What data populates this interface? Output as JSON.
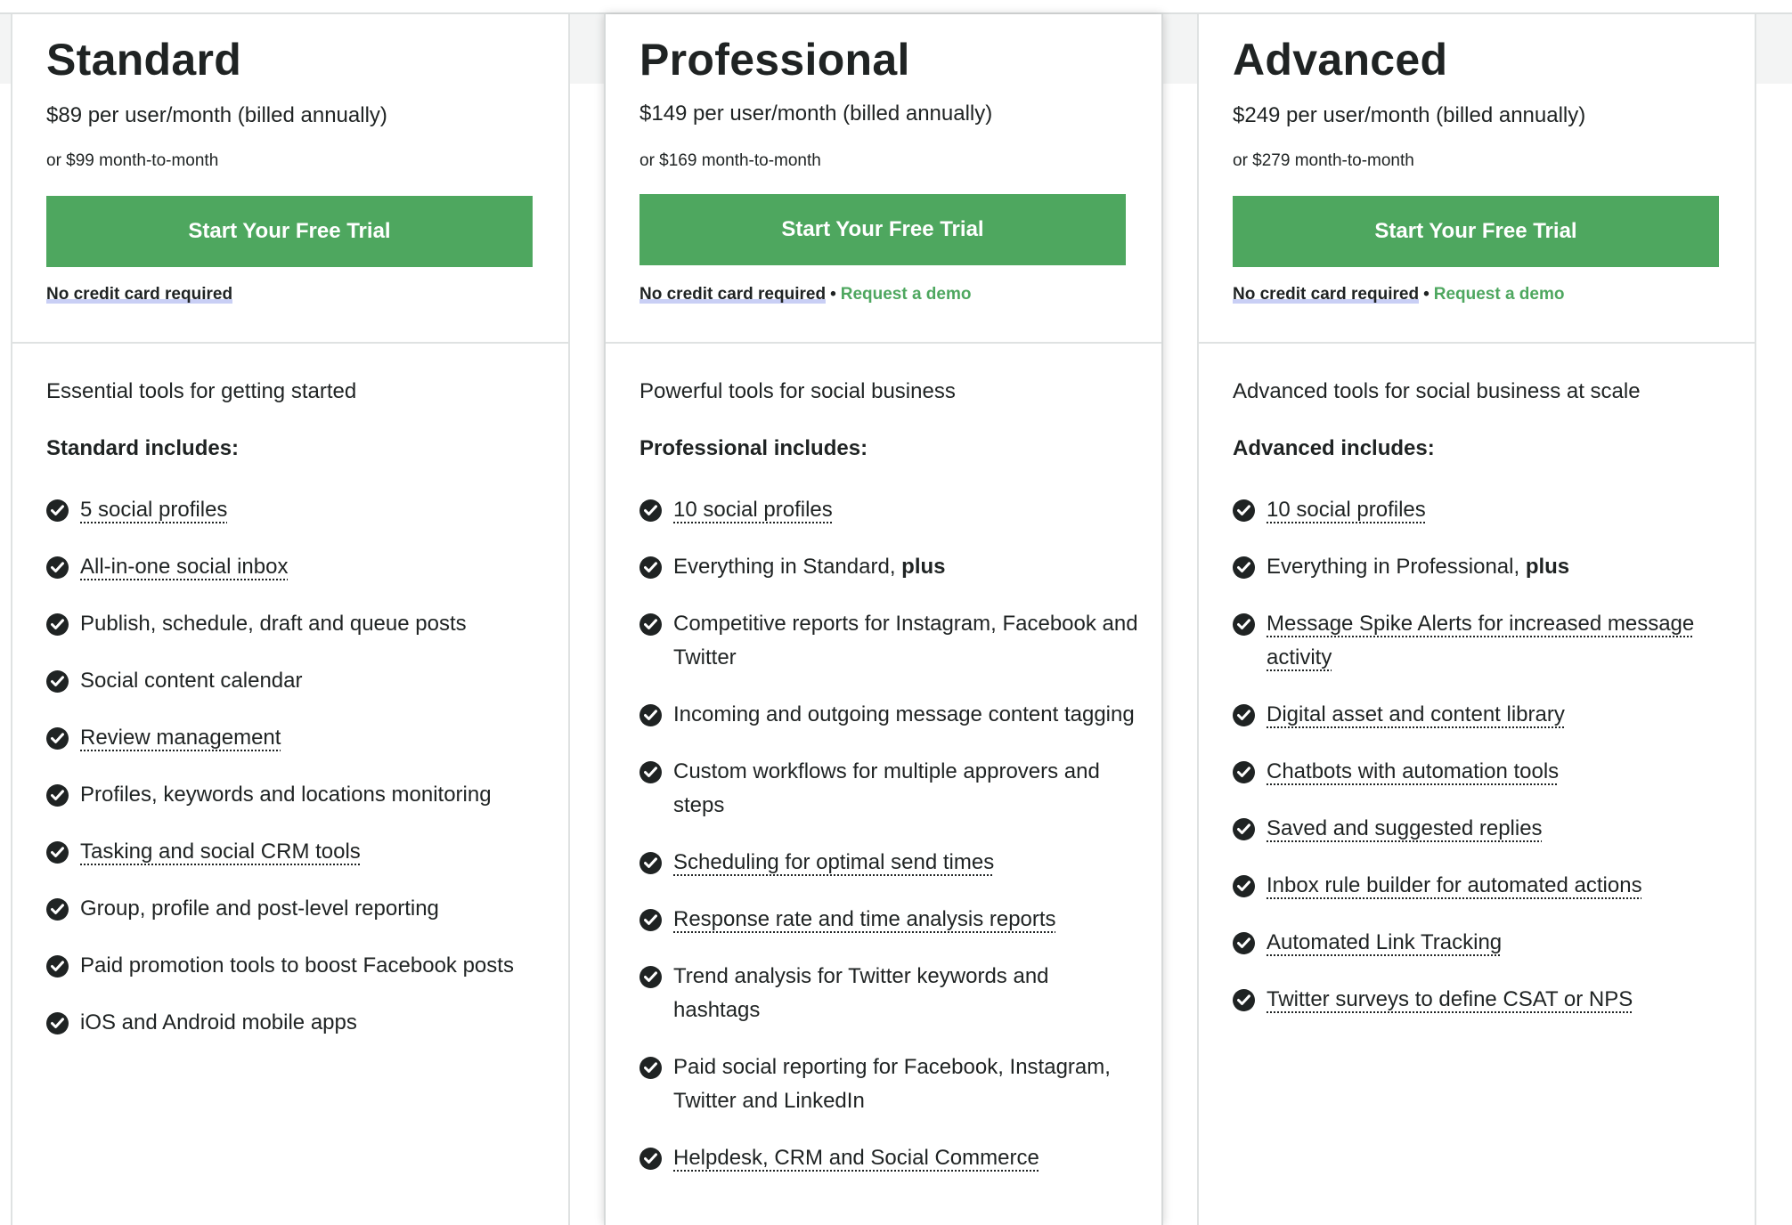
{
  "colors": {
    "accent": "#4ea75f",
    "text": "#1f2323",
    "highlight": "#c9cff5"
  },
  "plans": [
    {
      "name": "Standard",
      "price_annual": "$89 per user/month (billed annually)",
      "price_monthly": "or $99 month-to-month",
      "cta": "Start Your Free Trial",
      "no_card": "No credit card required",
      "tagline": "Essential tools for getting started",
      "includes_title": "Standard includes:",
      "features": [
        {
          "text": "5 social profiles",
          "link": true
        },
        {
          "text": "All-in-one social inbox",
          "link": true
        },
        {
          "text": "Publish, schedule, draft and queue posts",
          "link": false
        },
        {
          "text": "Social content calendar",
          "link": false
        },
        {
          "text": "Review management",
          "link": true
        },
        {
          "text": "Profiles, keywords and locations monitoring",
          "link": false
        },
        {
          "text": "Tasking and social CRM tools",
          "link": true
        },
        {
          "text": "Group, profile and post-level reporting",
          "link": false
        },
        {
          "text": "Paid promotion tools to boost Facebook posts",
          "link": false
        },
        {
          "text": "iOS and Android mobile apps",
          "link": false
        }
      ]
    },
    {
      "name": "Professional",
      "price_annual": "$149 per user/month (billed annually)",
      "price_monthly": "or $169 month-to-month",
      "cta": "Start Your Free Trial",
      "no_card": "No credit card required",
      "demo": "Request a demo",
      "tagline": "Powerful tools for social business",
      "includes_title": "Professional includes:",
      "features": [
        {
          "text": "10 social profiles",
          "link": true
        },
        {
          "text": "Everything in Standard, ",
          "bold": "plus",
          "link": false
        },
        {
          "text": "Competitive reports for Instagram, Facebook and Twitter",
          "link": false
        },
        {
          "text": "Incoming and outgoing message content tagging",
          "link": false
        },
        {
          "text": "Custom workflows for multiple approvers and steps",
          "link": false
        },
        {
          "text": "Scheduling for optimal send times",
          "link": true
        },
        {
          "text": "Response rate and time analysis reports",
          "link": true
        },
        {
          "text": "Trend analysis for Twitter keywords and hashtags",
          "link": false
        },
        {
          "text": "Paid social reporting for Facebook, Instagram, Twitter and LinkedIn",
          "link": false
        },
        {
          "text": "Helpdesk, CRM and Social Commerce",
          "link": true
        }
      ]
    },
    {
      "name": "Advanced",
      "price_annual": "$249 per user/month (billed annually)",
      "price_monthly": "or $279 month-to-month",
      "cta": "Start Your Free Trial",
      "no_card": "No credit card required",
      "demo": "Request a demo",
      "tagline": "Advanced tools for social business at scale",
      "includes_title": "Advanced includes:",
      "features": [
        {
          "text": "10 social profiles",
          "link": true
        },
        {
          "text": "Everything in Professional, ",
          "bold": "plus",
          "link": false
        },
        {
          "text": "Message Spike Alerts for increased message activity",
          "link": true
        },
        {
          "text": "Digital asset and content library",
          "link": true
        },
        {
          "text": "Chatbots with automation tools",
          "link": true
        },
        {
          "text": "Saved and suggested replies",
          "link": true
        },
        {
          "text": "Inbox rule builder for automated actions",
          "link": true
        },
        {
          "text": "Automated Link Tracking",
          "link": true
        },
        {
          "text": "Twitter surveys to define CSAT or NPS",
          "link": true
        }
      ]
    }
  ]
}
